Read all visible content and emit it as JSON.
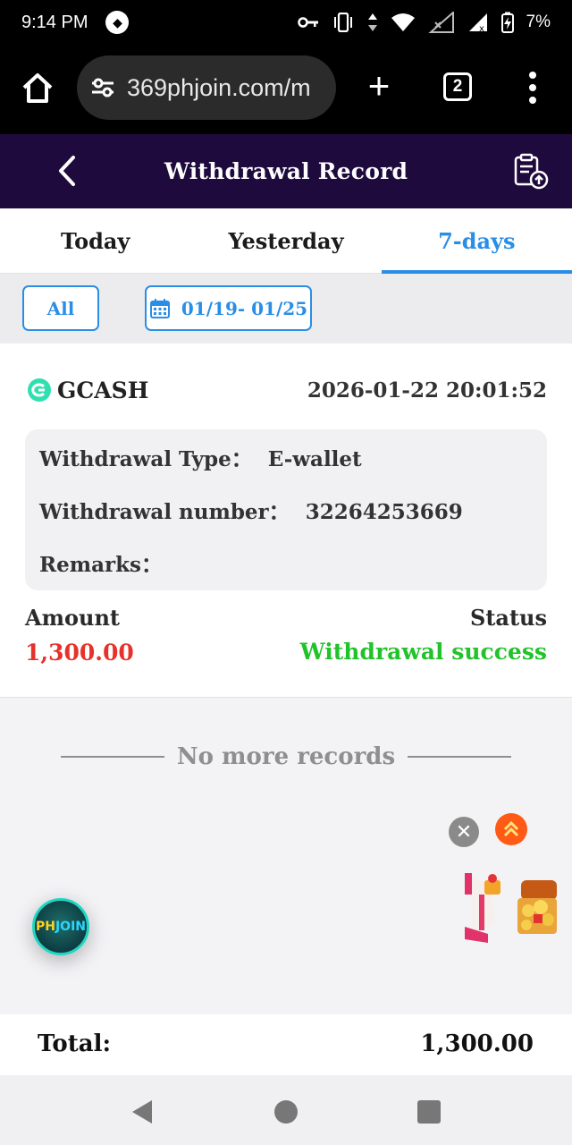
{
  "status_bar": {
    "time": "9:14 PM",
    "battery": "7%",
    "icons": [
      "notification-icon",
      "vpn-key-icon",
      "vibrate-icon",
      "data-arrows-icon",
      "wifi-icon",
      "signal-icon",
      "signal-roaming-icon",
      "battery-charging-icon"
    ]
  },
  "browser": {
    "url": "369phjoin.com/m",
    "tab_count": "2"
  },
  "header": {
    "title": "Withdrawal Record"
  },
  "tabs": [
    {
      "label": "Today",
      "active": false
    },
    {
      "label": "Yesterday",
      "active": false
    },
    {
      "label": "7-days",
      "active": true
    }
  ],
  "filters": {
    "all_label": "All",
    "date_range": "01/19- 01/25"
  },
  "record": {
    "method": "GCASH",
    "datetime": "2026-01-22 20:01:52",
    "type_label": "Withdrawal Type：",
    "type_value": "E-wallet",
    "number_label": "Withdrawal number：",
    "number_value": "32264253669",
    "remarks_label": "Remarks：",
    "remarks_value": "",
    "amount_label": "Amount",
    "amount_value": "1,300.00",
    "status_label": "Status",
    "status_value": "Withdrawal success"
  },
  "list_end_text": "No more records",
  "floating": {
    "badge_ph": "PH",
    "badge_join": "JOIN",
    "close_glyph": "✕"
  },
  "total": {
    "label": "Total:",
    "value": "1,300.00"
  },
  "colors": {
    "header_bg": "#1f0a3d",
    "accent_blue": "#2a8ee6",
    "amount_red": "#e6322a",
    "success_green": "#22c22a",
    "scroll_top_orange": "#ff5a16"
  }
}
